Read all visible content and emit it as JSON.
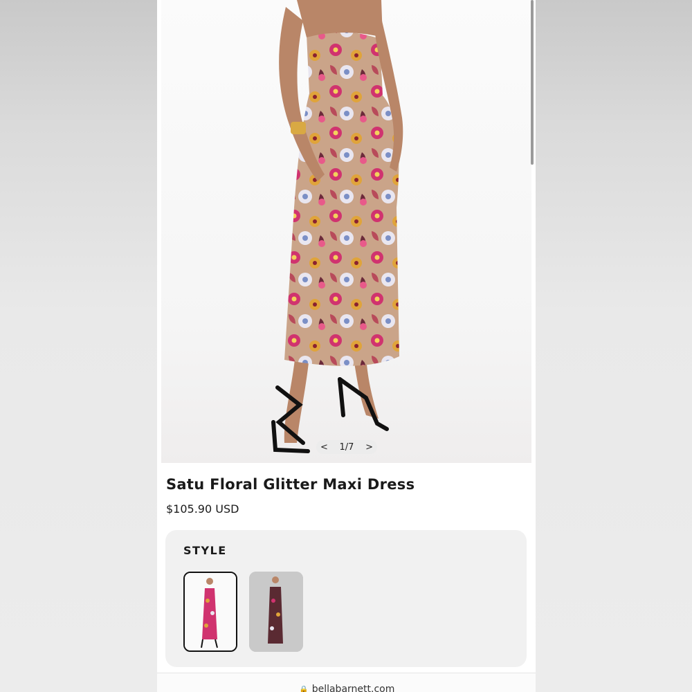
{
  "gallery": {
    "counter_text": "1/7",
    "prev_glyph": "<",
    "next_glyph": ">",
    "image_alt": "model wearing strapless floral sequin maxi dress with black strappy heels"
  },
  "product": {
    "title": "Satu Floral Glitter Maxi Dress",
    "price": "$105.90 USD"
  },
  "style": {
    "label": "STYLE",
    "options": [
      {
        "name": "floral-white-background",
        "selected": true
      },
      {
        "name": "floral-grey-background",
        "selected": false
      }
    ]
  },
  "browser": {
    "url": "bellabarnett.com",
    "lock_icon": "lock-icon"
  },
  "colors": {
    "page_bg": "#ececec",
    "panel_bg": "#f1f1f1",
    "text": "#1a1a1a",
    "dress_pink": "#d0336f",
    "dress_gold": "#e0a43a",
    "heels": "#111111"
  }
}
